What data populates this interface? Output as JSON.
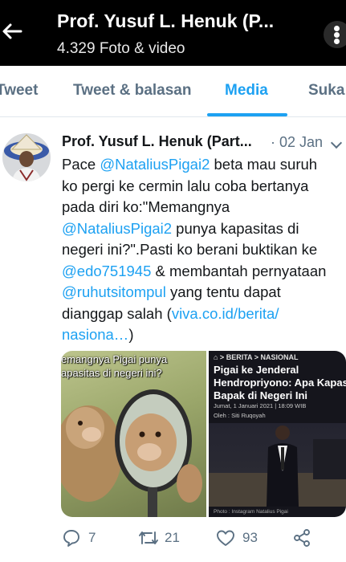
{
  "header": {
    "title": "Prof. Yusuf L. Henuk (P...",
    "subtitle": "4.329 Foto & video"
  },
  "tabs": [
    {
      "label": "Tweet"
    },
    {
      "label": "Tweet & balasan"
    },
    {
      "label": "Media"
    },
    {
      "label": "Suka"
    }
  ],
  "active_tab": "Media",
  "tweet": {
    "author": "Prof. Yusuf L. Henuk (Part...",
    "date": "· 02 Jan",
    "lines": [
      {
        "pre": "Pace ",
        "link": "@NataliusPigai2",
        "post": " beta mau suruh"
      },
      {
        "pre": "ko pergi ke cermin lalu coba bertanya",
        "link": "",
        "post": ""
      },
      {
        "pre": "pada diri ko:\"Memangnya",
        "link": "",
        "post": ""
      },
      {
        "pre": "",
        "link": "@NataliusPigai2",
        "post": " punya kapasitas di"
      },
      {
        "pre": "negeri ini?\".Pasti ko berani buktikan ke",
        "link": "",
        "post": ""
      },
      {
        "pre": "",
        "link": "@edo751945",
        "post": " & membantah pernyataan"
      },
      {
        "pre": "",
        "link": "@ruhutsitompul",
        "post": " yang tentu dapat"
      },
      {
        "pre": "dianggap salah (",
        "link": "viva.co.id/berita/",
        "post": ""
      },
      {
        "pre": "",
        "link": "nasiona…",
        "post": ")"
      }
    ],
    "media_left": {
      "caption_lines": [
        "emangnya Pigai punya",
        "apasitas di negeri ini?"
      ]
    },
    "media_right": {
      "breadcrumb": "⌂ > BERITA > NASIONAL",
      "title_lines": [
        "Pigai ke Jenderal",
        "Hendropriyono: Apa Kapasita",
        "Bapak di Negeri Ini"
      ],
      "date": "Jumat, 1 Januari 2021 | 18:09 WIB",
      "author": "Oleh : Siti Ruqoyah",
      "credit": "Photo : Instagram Natalius Pigai"
    },
    "stats": {
      "replies": "7",
      "retweets": "21",
      "likes": "93"
    }
  },
  "colors": {
    "accent": "#1da1f2",
    "header_bg": "#000000",
    "muted": "#5b7083"
  },
  "icons": [
    "back-arrow-icon",
    "more-options-icon",
    "reply-icon",
    "retweet-icon",
    "like-icon",
    "share-icon"
  ]
}
